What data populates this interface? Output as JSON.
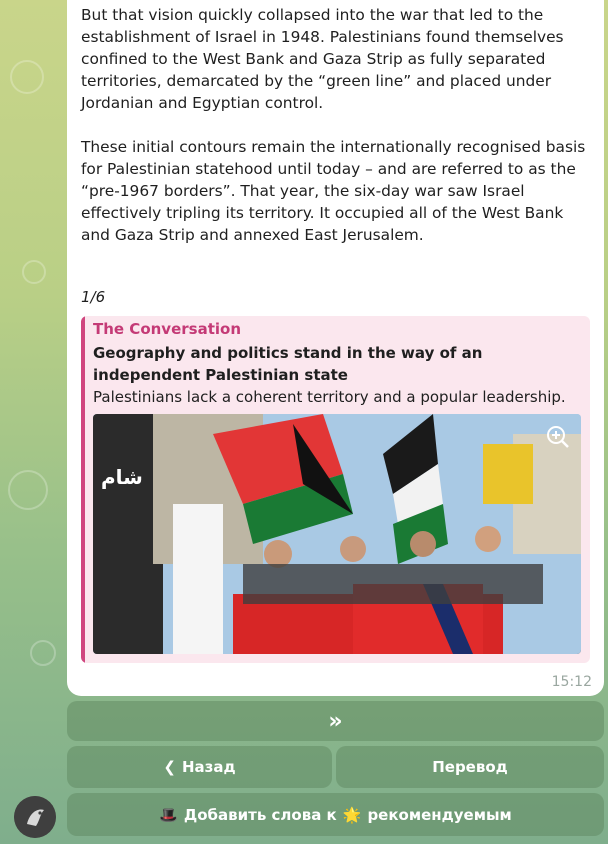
{
  "message": {
    "paragraphs": [
      "But that vision quickly collapsed into the war that led to the establishment of Israel in 1948. Palestinians found themselves confined to the West Bank and Gaza Strip as fully separated territories, demarcated by the “green line” and placed under Jordanian and Egyptian control.",
      "These initial contours remain the internationally recognised basis for Palestinian statehood until today – and are referred to as the “pre-1967 borders”. That year, the six-day war saw Israel effectively tripling its territory. It occupied all of the West Bank and Gaza Strip and annexed East Jerusalem."
    ],
    "counter": "1/6",
    "timestamp": "15:12",
    "link_preview": {
      "site_name": "The Conversation",
      "title": "Geography and politics stand in the way of an independent Palestinian state",
      "description": "Palestinians lack a coherent territory and a popular leadership.",
      "image_icon": "zoom-icon"
    }
  },
  "keyboard": {
    "next_label": "»",
    "back_label": "Назад",
    "back_icon": "chevron-left-icon",
    "translate_label": "Перевод",
    "recommend_prefix": "Добавить слова к",
    "recommend_suffix": "рекомендуемым",
    "recommend_icons": [
      "top-hat-icon",
      "star-icon"
    ]
  },
  "avatar_icon": "bot-avatar-icon",
  "colors": {
    "accent": "#c43a76",
    "bubble": "#ffffff",
    "preview_bg": "#fbe7ee",
    "button_bg": "#5a825a"
  }
}
